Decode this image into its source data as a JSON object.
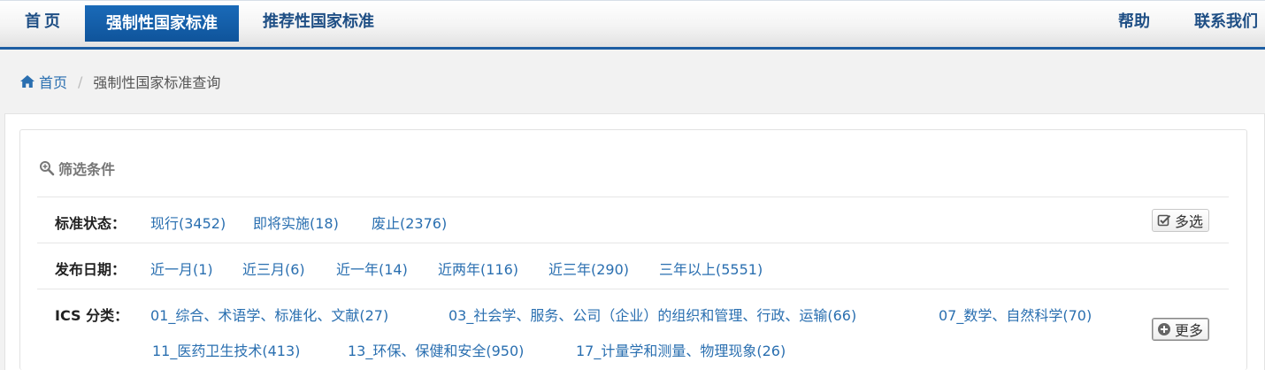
{
  "nav": {
    "home": "首页",
    "mandatory": "强制性国家标准",
    "recommended": "推荐性国家标准",
    "help": "帮助",
    "contact": "联系我们"
  },
  "breadcrumb": {
    "home": "首页",
    "separator": "/",
    "current": "强制性国家标准查询"
  },
  "filter": {
    "title": "筛选条件",
    "status": {
      "label": "标准状态：",
      "options": [
        "现行(3452)",
        "即将实施(18)",
        "废止(2376)"
      ],
      "multi_button": "多选"
    },
    "date": {
      "label": "发布日期：",
      "options": [
        "近一月(1)",
        "近三月(6)",
        "近一年(14)",
        "近两年(116)",
        "近三年(290)",
        "三年以上(5551)"
      ]
    },
    "ics": {
      "label": "ICS 分类：",
      "options": [
        "01_综合、术语学、标准化、文献(27)",
        "03_社会学、服务、公司（企业）的组织和管理、行政、运输(66)",
        "07_数学、自然科学(70)",
        "11_医药卫生技术(413)",
        "13_环保、保健和安全(950)",
        "17_计量学和测量、物理现象(26)"
      ],
      "more_button": "更多"
    }
  },
  "colors": {
    "nav_active_bg": "#1563ad",
    "nav_text": "#1f4f85",
    "link": "#2a6fb0",
    "nav_bottom_border": "#1d5ea3"
  },
  "icons": [
    "home-icon",
    "search-zoom-icon",
    "checkbox-edit-icon",
    "plus-circle-icon"
  ]
}
